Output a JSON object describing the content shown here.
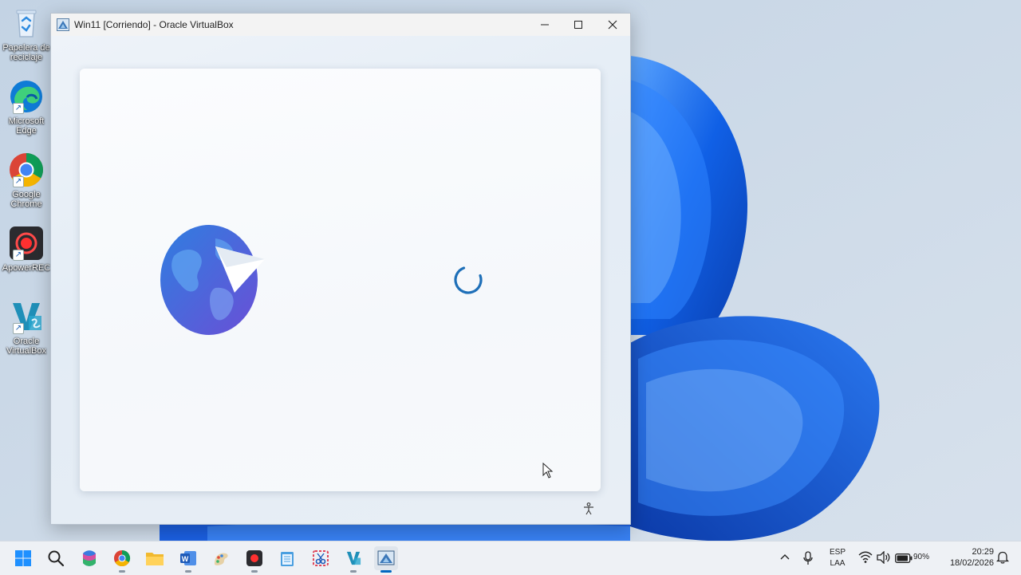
{
  "desktop": {
    "icons": [
      {
        "name": "recycle-bin",
        "label": "Papelera de reciclaje"
      },
      {
        "name": "microsoft-edge",
        "label": "Microsoft Edge"
      },
      {
        "name": "google-chrome",
        "label": "Google Chrome"
      },
      {
        "name": "apowerrec",
        "label": "ApowerREC"
      },
      {
        "name": "oracle-virtualbox",
        "label": "Oracle VirtualBox"
      }
    ]
  },
  "window": {
    "title": "Win11 [Corriendo] - Oracle VirtualBox",
    "controls": [
      "minimize",
      "maximize",
      "close"
    ],
    "screen": {
      "state": "loading",
      "icons": [
        "globe-icon",
        "paper-plane-icon",
        "loading-spinner",
        "accessibility-icon"
      ]
    }
  },
  "taskbar": {
    "apps": [
      "start-icon",
      "search-icon",
      "microsoft-365-icon",
      "chrome-icon",
      "file-explorer-icon",
      "word-icon",
      "paint-icon",
      "apowerrec-icon",
      "notepad-icon",
      "snipping-tool-icon",
      "virtualbox-icon",
      "virtualbox-vm-icon"
    ],
    "active_app": "virtualbox-vm-icon",
    "tray": {
      "lang_line1": "ESP",
      "lang_line2": "LAA",
      "battery": "90%",
      "time": "20:29",
      "date": "18/02/2026"
    }
  },
  "colors": {
    "accent": "#0067c0",
    "wallpaper_bloom": "#1a5fe0",
    "spinner": "#1e6fb8"
  }
}
